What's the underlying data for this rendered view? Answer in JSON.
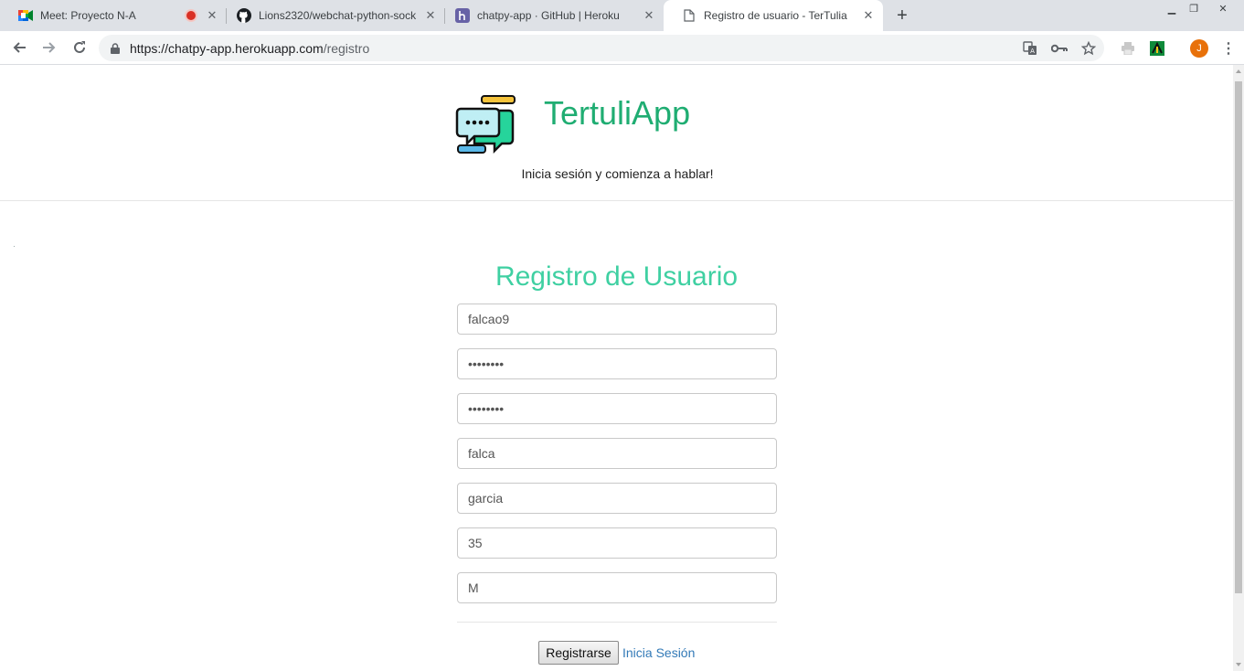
{
  "browser": {
    "tabs": [
      {
        "title": "Meet: Proyecto N-A",
        "icon": "google-meet-icon",
        "recording": true
      },
      {
        "title": "Lions2320/webchat-python-sock",
        "icon": "github-icon"
      },
      {
        "title": "chatpy-app · GitHub | Heroku",
        "icon": "heroku-icon"
      },
      {
        "title": "Registro de usuario - TerTulia",
        "icon": "page-icon",
        "active": true
      }
    ],
    "url_host": "https://chatpy-app.herokuapp.com",
    "url_path": "/registro",
    "profile_initial": "J"
  },
  "header": {
    "brand": "TertuliApp",
    "tagline": "Inicia sesión y comienza a hablar!"
  },
  "form": {
    "title": "Registro de Usuario",
    "fields": {
      "username": "falcao9",
      "password": "••••••••",
      "password_confirm": "••••••••",
      "first_name": "falca",
      "last_name": "garcia",
      "age": "35",
      "gender": "M"
    },
    "submit_label": "Registrarse",
    "login_link_label": "Inicia Sesión"
  },
  "colors": {
    "brand_green": "#1fad72",
    "title_teal": "#3fd0a2",
    "link_blue": "#337ab7"
  }
}
